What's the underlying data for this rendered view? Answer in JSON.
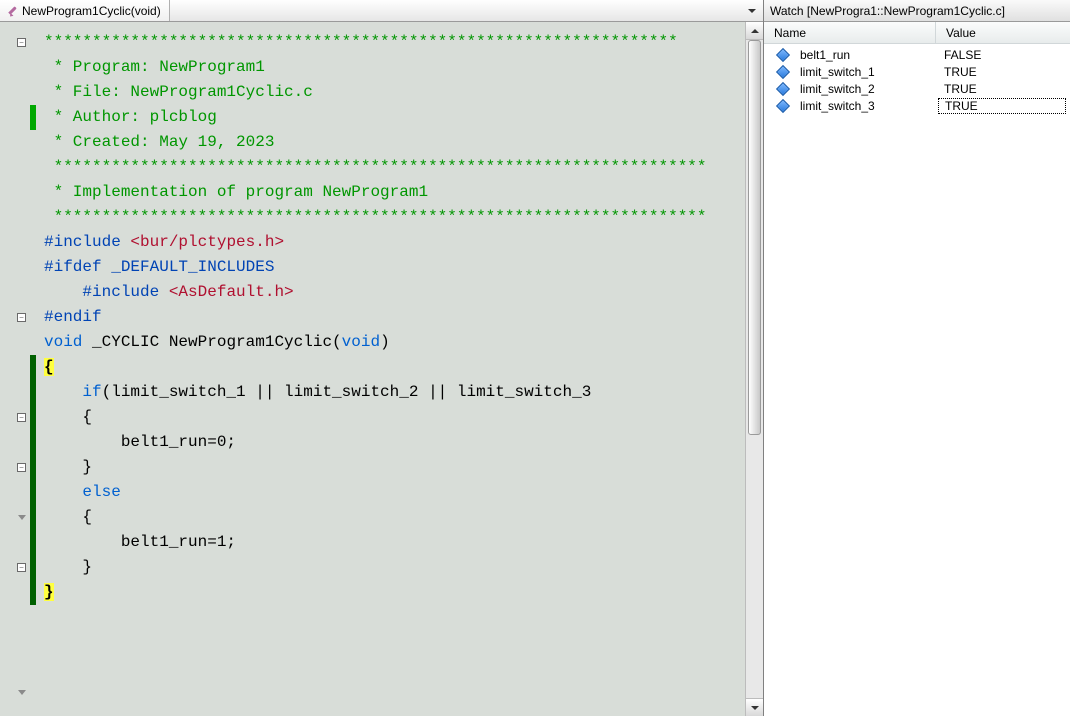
{
  "editor": {
    "tab_label": "NewProgram1Cyclic(void)",
    "lines": [
      {
        "fold": "minus",
        "segs": [
          {
            "cls": "c-cmt",
            "txt": "******************************************************************"
          }
        ]
      },
      {
        "segs": [
          {
            "cls": "c-cmt",
            "txt": " * Program: NewProgram1"
          }
        ]
      },
      {
        "segs": [
          {
            "cls": "c-cmt",
            "txt": " * File: NewProgram1Cyclic.c"
          }
        ]
      },
      {
        "mark": "green",
        "segs": [
          {
            "cls": "c-cmt",
            "txt": " * Author: plcblog"
          }
        ]
      },
      {
        "segs": [
          {
            "cls": "c-cmt",
            "txt": " * Created: May 19, 2023"
          }
        ]
      },
      {
        "segs": [
          {
            "cls": "c-cmt",
            "txt": " ********************************************************************"
          }
        ]
      },
      {
        "segs": [
          {
            "cls": "c-cmt",
            "txt": " * Implementation of program NewProgram1"
          }
        ]
      },
      {
        "segs": [
          {
            "cls": "c-cmt",
            "txt": " ********************************************************************"
          }
        ]
      },
      {
        "segs": [
          {
            "cls": "",
            "txt": ""
          }
        ]
      },
      {
        "segs": [
          {
            "cls": "c-prep",
            "txt": "#include "
          },
          {
            "cls": "c-inc",
            "txt": "<bur/plctypes.h>"
          }
        ]
      },
      {
        "segs": [
          {
            "cls": "",
            "txt": ""
          }
        ]
      },
      {
        "fold": "minus",
        "segs": [
          {
            "cls": "c-prep",
            "txt": "#ifdef _DEFAULT_INCLUDES"
          }
        ]
      },
      {
        "segs": [
          {
            "cls": "",
            "txt": "    "
          },
          {
            "cls": "c-prep",
            "txt": "#include "
          },
          {
            "cls": "c-inc",
            "txt": "<AsDefault.h>"
          }
        ]
      },
      {
        "segs": [
          {
            "cls": "c-prep",
            "txt": "#endif"
          }
        ]
      },
      {
        "segs": [
          {
            "cls": "",
            "txt": ""
          }
        ]
      },
      {
        "fold": "minus",
        "segs": [
          {
            "cls": "c-kw",
            "txt": "void "
          },
          {
            "cls": "c-id",
            "txt": "_CYCLIC NewProgram1Cyclic("
          },
          {
            "cls": "c-kw",
            "txt": "void"
          },
          {
            "cls": "c-id",
            "txt": ")"
          }
        ]
      },
      {
        "mark": "dark",
        "segs": [
          {
            "cls": "c-brace-hl",
            "txt": "{"
          }
        ]
      },
      {
        "mark": "dark",
        "fold": "minus",
        "segs": [
          {
            "cls": "c-id",
            "txt": "    "
          },
          {
            "cls": "c-kw",
            "txt": "if"
          },
          {
            "cls": "c-id",
            "txt": "(limit_switch_1 || limit_switch_2 || limit_switch_3"
          }
        ]
      },
      {
        "mark": "dark",
        "segs": [
          {
            "cls": "c-id",
            "txt": "    {"
          }
        ]
      },
      {
        "mark": "dark",
        "arrow": true,
        "segs": [
          {
            "cls": "c-id",
            "txt": "        belt1_run=0;"
          }
        ]
      },
      {
        "mark": "dark",
        "segs": [
          {
            "cls": "c-id",
            "txt": "    }"
          }
        ]
      },
      {
        "mark": "dark",
        "fold": "minus",
        "segs": [
          {
            "cls": "",
            "txt": "    "
          },
          {
            "cls": "c-kw",
            "txt": "else"
          }
        ]
      },
      {
        "mark": "dark",
        "segs": [
          {
            "cls": "c-id",
            "txt": "    {"
          }
        ]
      },
      {
        "mark": "dark",
        "segs": [
          {
            "cls": "c-id",
            "txt": "        belt1_run=1;"
          }
        ]
      },
      {
        "mark": "dark",
        "segs": [
          {
            "cls": "c-id",
            "txt": "    }"
          }
        ]
      },
      {
        "mark": "dark",
        "segs": [
          {
            "cls": "",
            "txt": ""
          }
        ]
      },
      {
        "mark": "dark",
        "arrow": true,
        "segs": [
          {
            "cls": "c-brace-hl",
            "txt": "}"
          }
        ]
      }
    ]
  },
  "watch": {
    "title": "Watch [NewProgra1::NewProgram1Cyclic.c]",
    "col_name": "Name",
    "col_value": "Value",
    "rows": [
      {
        "name": "belt1_run",
        "value": "FALSE",
        "selected": false
      },
      {
        "name": "limit_switch_1",
        "value": "TRUE",
        "selected": false
      },
      {
        "name": "limit_switch_2",
        "value": "TRUE",
        "selected": false
      },
      {
        "name": "limit_switch_3",
        "value": "TRUE",
        "selected": true
      }
    ]
  }
}
